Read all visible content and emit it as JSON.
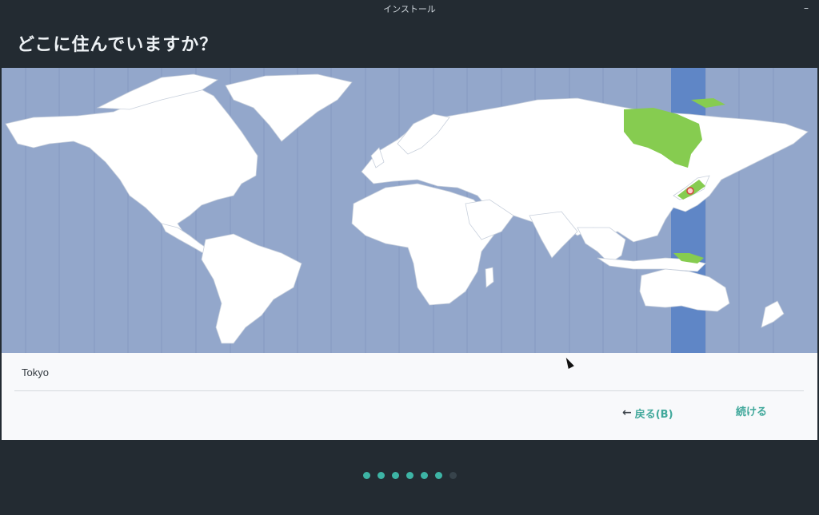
{
  "window": {
    "title": "インストール",
    "minimize_label": "–"
  },
  "page": {
    "heading": "どこに住んでいますか？"
  },
  "map": {
    "highlight_color": "#5f86c6",
    "selected_region_color": "#86cc50",
    "ocean_color": "#93a7cb",
    "land_color": "#ffffff",
    "marker": "timezone-marker-icon"
  },
  "location": {
    "value": "Tokyo"
  },
  "buttons": {
    "back_label": "戻る(B)",
    "back_icon": "arrow-left-icon",
    "continue_label": "続ける"
  },
  "progress": {
    "total_steps": 7,
    "current_step": 6,
    "accent": "#3db4a5"
  }
}
